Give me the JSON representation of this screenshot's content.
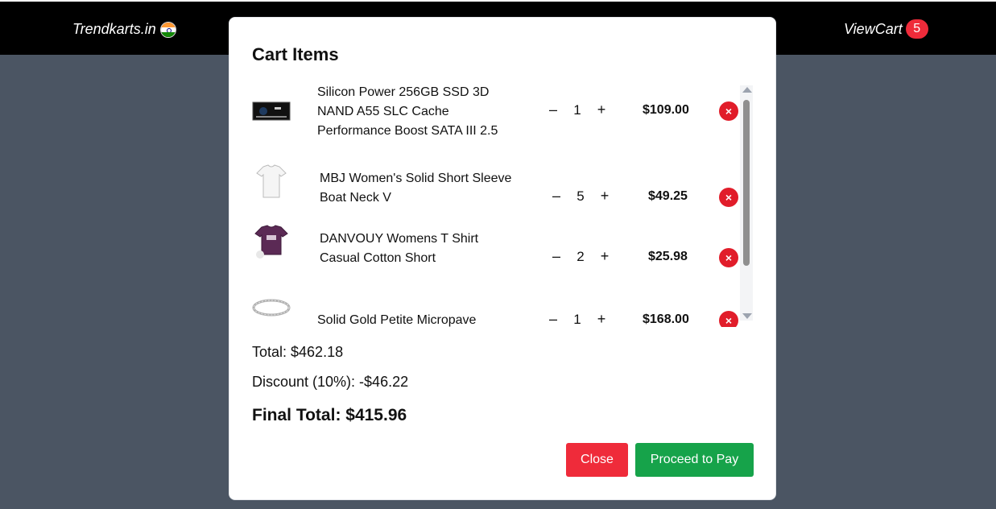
{
  "header": {
    "brand": "Trendkarts.in",
    "flag_icon": "india-flag-icon",
    "viewcart_label": "ViewCart",
    "cart_count": "5"
  },
  "modal": {
    "title": "Cart Items",
    "items": [
      {
        "name": "Silicon Power 256GB SSD 3D NAND A55 SLC Cache Performance Boost SATA III 2.5",
        "qty": "1",
        "price": "$109.00",
        "minus": "–",
        "plus": "+",
        "remove": "×",
        "thumb_icon": "ssd-product-icon"
      },
      {
        "name": "MBJ Women's Solid Short Sleeve Boat Neck V",
        "qty": "5",
        "price": "$49.25",
        "minus": "–",
        "plus": "+",
        "remove": "×",
        "thumb_icon": "white-tshirt-product-icon"
      },
      {
        "name": "DANVOUY Womens T Shirt Casual Cotton Short",
        "qty": "2",
        "price": "$25.98",
        "minus": "–",
        "plus": "+",
        "remove": "×",
        "thumb_icon": "purple-tshirt-product-icon"
      },
      {
        "name": "Solid Gold Petite Micropave",
        "qty": "1",
        "price": "$168.00",
        "minus": "–",
        "plus": "+",
        "remove": "×",
        "thumb_icon": "ring-product-icon"
      }
    ],
    "total": "Total: $462.18",
    "discount": "Discount (10%): -$46.22",
    "final_total": "Final Total: $415.96",
    "close_label": "Close",
    "pay_label": "Proceed to Pay"
  },
  "colors": {
    "accent_red": "#ef2b3a",
    "accent_green": "#16a34a",
    "backdrop": "#4b5563"
  }
}
